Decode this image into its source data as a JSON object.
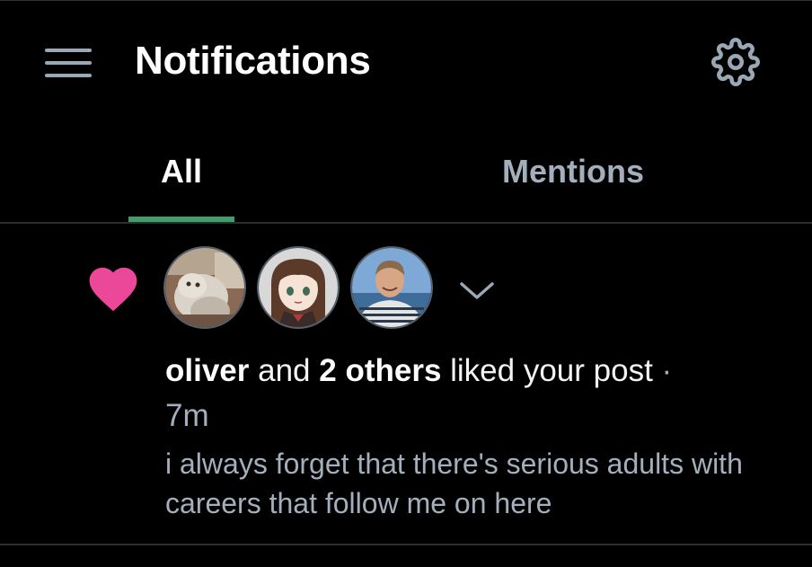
{
  "header": {
    "title": "Notifications",
    "menu_icon": "hamburger-menu-icon",
    "settings_icon": "gear-icon"
  },
  "tabs": [
    {
      "label": "All",
      "active": true
    },
    {
      "label": "Mentions",
      "active": false
    }
  ],
  "notifications": [
    {
      "type_icon": "heart-icon",
      "avatars": [
        {
          "name": "cat-photo-avatar"
        },
        {
          "name": "anime-girl-avatar"
        },
        {
          "name": "man-smiling-avatar"
        }
      ],
      "expand_icon": "chevron-down-icon",
      "actor": "oliver",
      "conjunction": " and ",
      "others": "2 others",
      "action": " liked your post",
      "separator": " · ",
      "time": "7m",
      "post_text": "i always forget that there's serious adults with careers that follow me on here"
    }
  ],
  "colors": {
    "background": "#000000",
    "accent": "#3f9e6a",
    "heart": "#ec4899",
    "muted_text": "#a3afbd",
    "divider": "#2b2f33"
  }
}
